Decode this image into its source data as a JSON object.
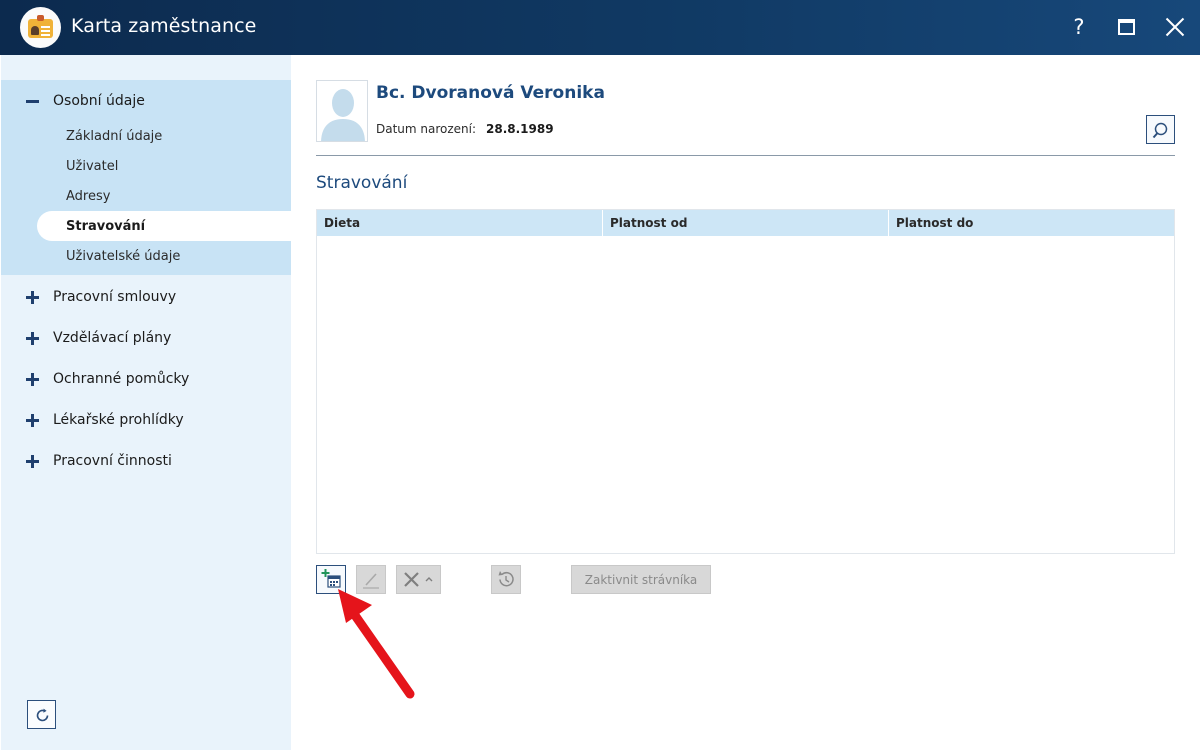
{
  "window": {
    "title": "Karta zaměstnance",
    "help_label": "?"
  },
  "sidebar": {
    "groups": [
      {
        "label": "Osobní údaje",
        "expanded": true
      },
      {
        "label": "Pracovní smlouvy",
        "expanded": false
      },
      {
        "label": "Vzdělávací plány",
        "expanded": false
      },
      {
        "label": "Ochranné pomůcky",
        "expanded": false
      },
      {
        "label": "Lékařské prohlídky",
        "expanded": false
      },
      {
        "label": "Pracovní činnosti",
        "expanded": false
      }
    ],
    "sub_items": [
      {
        "label": "Základní údaje",
        "selected": false
      },
      {
        "label": "Uživatel",
        "selected": false
      },
      {
        "label": "Adresy",
        "selected": false
      },
      {
        "label": "Stravování",
        "selected": true
      },
      {
        "label": "Uživatelské údaje",
        "selected": false
      }
    ]
  },
  "employee": {
    "name": "Bc. Dvoranová Veronika",
    "dob_label": "Datum narození:",
    "dob_value": "28.8.1989"
  },
  "section": {
    "title": "Stravování",
    "columns": [
      "Dieta",
      "Platnost od",
      "Platnost do"
    ],
    "rows": []
  },
  "toolbar": {
    "activate_label": "Zaktivnit strávníka",
    "add_icon": "add-calendar-icon",
    "edit_icon": "pencil-icon",
    "delete_icon": "delete-x-icon",
    "history_icon": "history-icon"
  },
  "colors": {
    "titlebar": "#103963",
    "accent": "#1d4a7d",
    "sidebar_bg": "#e9f3fb",
    "sidebar_active_group": "#c8e3f5",
    "grid_header": "#cde6f6",
    "arrow": "#e5141b"
  }
}
